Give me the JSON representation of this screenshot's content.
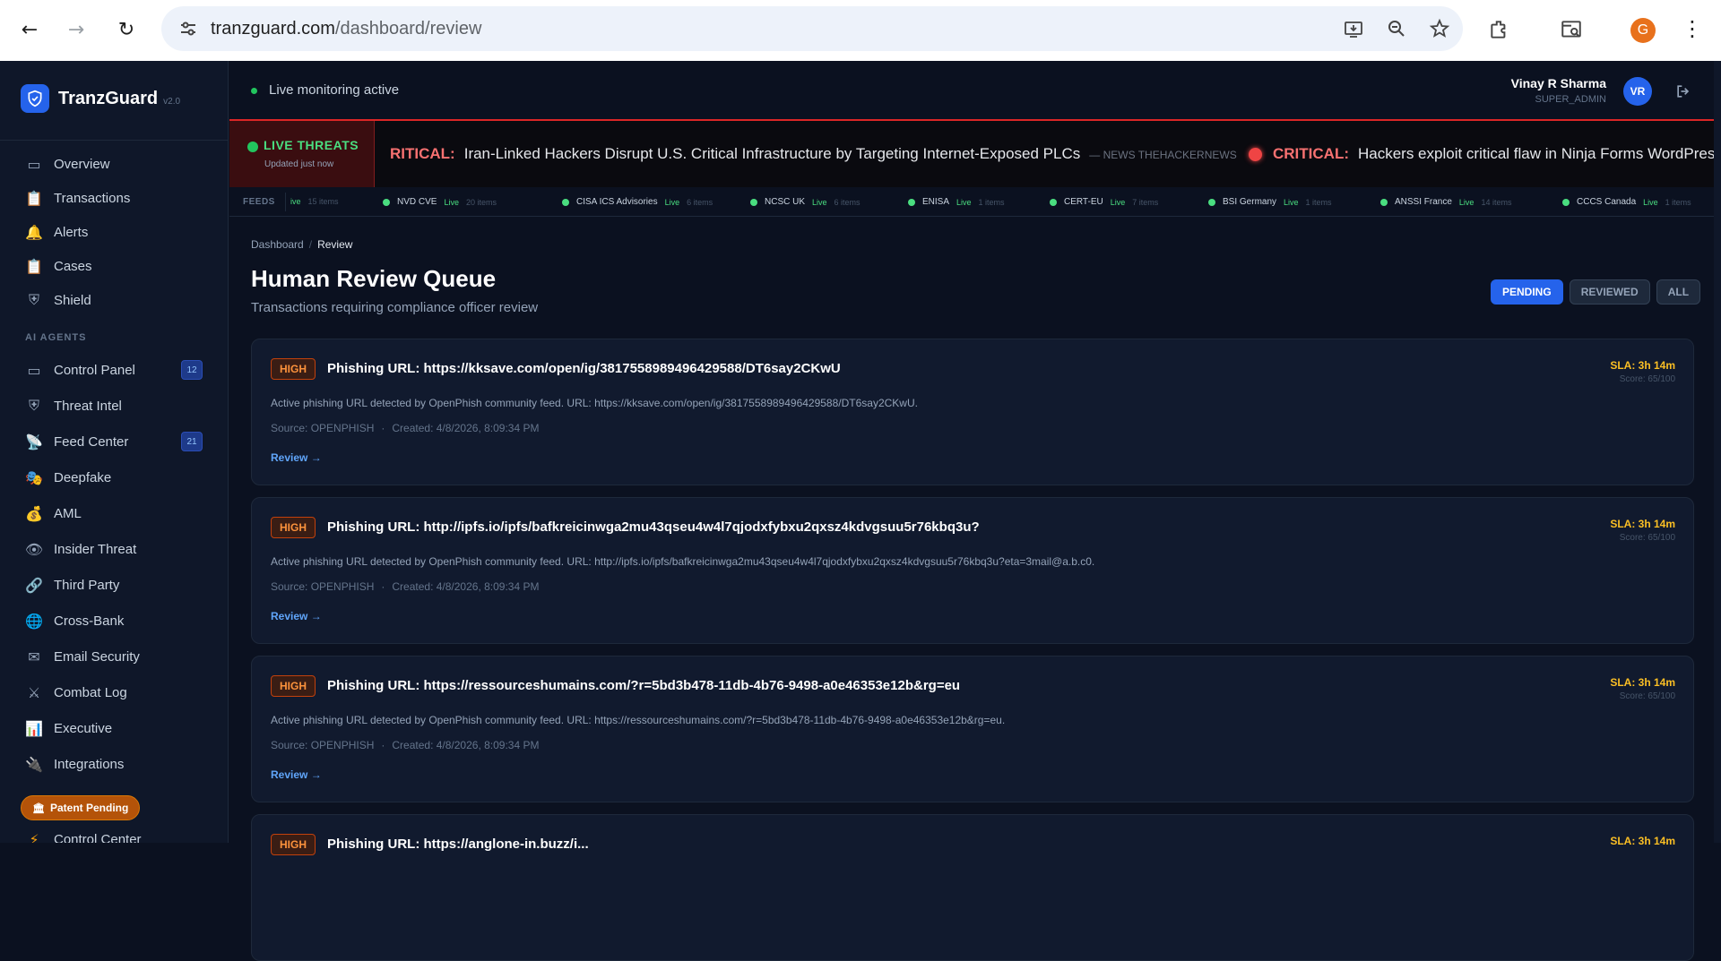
{
  "browser": {
    "url_domain": "tranzguard.com",
    "url_path": "/dashboard/review",
    "profile_initial": "G"
  },
  "brand": {
    "name": "TranzGuard",
    "version": "v2.0"
  },
  "sidebar": {
    "main_items": [
      {
        "label": "Overview",
        "icon": "monitor-icon"
      },
      {
        "label": "Transactions",
        "icon": "clipboard-icon"
      },
      {
        "label": "Alerts",
        "icon": "bell-icon"
      },
      {
        "label": "Cases",
        "icon": "clipboard-list-icon"
      },
      {
        "label": "Shield",
        "icon": "shield-icon"
      }
    ],
    "section_label": "AI AGENTS",
    "agent_items": [
      {
        "label": "Control Panel",
        "icon": "monitor-icon",
        "badge": "12"
      },
      {
        "label": "Threat Intel",
        "icon": "shield-icon"
      },
      {
        "label": "Feed Center",
        "icon": "satellite-icon",
        "badge": "21"
      },
      {
        "label": "Deepfake",
        "icon": "masks-icon"
      },
      {
        "label": "AML",
        "icon": "money-bag-icon"
      },
      {
        "label": "Insider Threat",
        "icon": "eye-icon"
      },
      {
        "label": "Third Party",
        "icon": "link-icon"
      },
      {
        "label": "Cross-Bank",
        "icon": "globe-icon"
      },
      {
        "label": "Email Security",
        "icon": "email-icon"
      },
      {
        "label": "Combat Log",
        "icon": "swords-icon"
      },
      {
        "label": "Executive",
        "icon": "bar-chart-icon"
      },
      {
        "label": "Integrations",
        "icon": "plug-icon"
      }
    ],
    "patent_label": "Patent Pending",
    "extra_item": {
      "label": "Control Center",
      "icon": "bolt-icon"
    }
  },
  "topbar": {
    "status": "Live monitoring active",
    "user_name": "Vinay R Sharma",
    "user_role": "SUPER_ADMIN",
    "avatar_initials": "VR"
  },
  "ticker": {
    "title": "LIVE THREATS",
    "subtitle": "Updated just now",
    "items": [
      {
        "severity": "RITICAL:",
        "headline": "Iran-Linked Hackers Disrupt U.S. Critical Infrastructure by Targeting Internet-Exposed PLCs",
        "source": "— NEWS THEHACKERNEWS"
      },
      {
        "severity": "CRITICAL:",
        "headline": "Hackers exploit critical flaw in Ninja Forms WordPress plug",
        "source": ""
      }
    ]
  },
  "feeds": {
    "label": "FEEDS",
    "items": [
      {
        "name": "",
        "status": "ive",
        "count": "15 items"
      },
      {
        "name": "NVD CVE",
        "status": "Live",
        "count": "20 items"
      },
      {
        "name": "CISA ICS Advisories",
        "status": "Live",
        "count": "6 items"
      },
      {
        "name": "NCSC UK",
        "status": "Live",
        "count": "6 items"
      },
      {
        "name": "ENISA",
        "status": "Live",
        "count": "1 items"
      },
      {
        "name": "CERT-EU",
        "status": "Live",
        "count": "7 items"
      },
      {
        "name": "BSI Germany",
        "status": "Live",
        "count": "1 items"
      },
      {
        "name": "ANSSI France",
        "status": "Live",
        "count": "14 items"
      },
      {
        "name": "CCCS Canada",
        "status": "Live",
        "count": "1 items"
      }
    ]
  },
  "page": {
    "breadcrumb": [
      "Dashboard",
      "Review"
    ],
    "breadcrumb_sep": "/",
    "title": "Human Review Queue",
    "subtitle": "Transactions requiring compliance officer review",
    "filters": [
      "PENDING",
      "REVIEWED",
      "ALL"
    ]
  },
  "cards": [
    {
      "severity": "HIGH",
      "title": "Phishing URL: https://kksave.com/open/ig/3817558989496429588/DT6say2CKwU",
      "description": "Active phishing URL detected by OpenPhish community feed. URL: https://kksave.com/open/ig/3817558989496429588/DT6say2CKwU.",
      "source": "Source: OPENPHISH",
      "created": "Created: 4/8/2026, 8:09:34 PM",
      "review": "Review →",
      "sla": "SLA: 3h 14m",
      "score": "Score: 65/100"
    },
    {
      "severity": "HIGH",
      "title": "Phishing URL: http://ipfs.io/ipfs/bafkreicinwga2mu43qseu4w4l7qjodxfybxu2qxsz4kdvgsuu5r76kbq3u?",
      "description": "Active phishing URL detected by OpenPhish community feed. URL: http://ipfs.io/ipfs/bafkreicinwga2mu43qseu4w4l7qjodxfybxu2qxsz4kdvgsuu5r76kbq3u?eta=3mail@a.b.c0.",
      "source": "Source: OPENPHISH",
      "created": "Created: 4/8/2026, 8:09:34 PM",
      "review": "Review →",
      "sla": "SLA: 3h 14m",
      "score": "Score: 65/100"
    },
    {
      "severity": "HIGH",
      "title": "Phishing URL: https://ressourceshumains.com/?r=5bd3b478-11db-4b76-9498-a0e46353e12b&rg=eu",
      "description": "Active phishing URL detected by OpenPhish community feed. URL: https://ressourceshumains.com/?r=5bd3b478-11db-4b76-9498-a0e46353e12b&rg=eu.",
      "source": "Source: OPENPHISH",
      "created": "Created: 4/8/2026, 8:09:34 PM",
      "review": "Review →",
      "sla": "SLA: 3h 14m",
      "score": "Score: 65/100"
    },
    {
      "severity": "HIGH",
      "title": "Phishing URL: https://anglone-in.buzz/i...",
      "description": "",
      "source": "",
      "created": "",
      "review": "",
      "sla": "SLA: 3h 14m",
      "score": ""
    }
  ],
  "colors": {
    "accent": "#2563eb",
    "critical": "#f87171",
    "live": "#22c55e",
    "sla": "#fbbf24",
    "severity_high": "#fb923c"
  }
}
